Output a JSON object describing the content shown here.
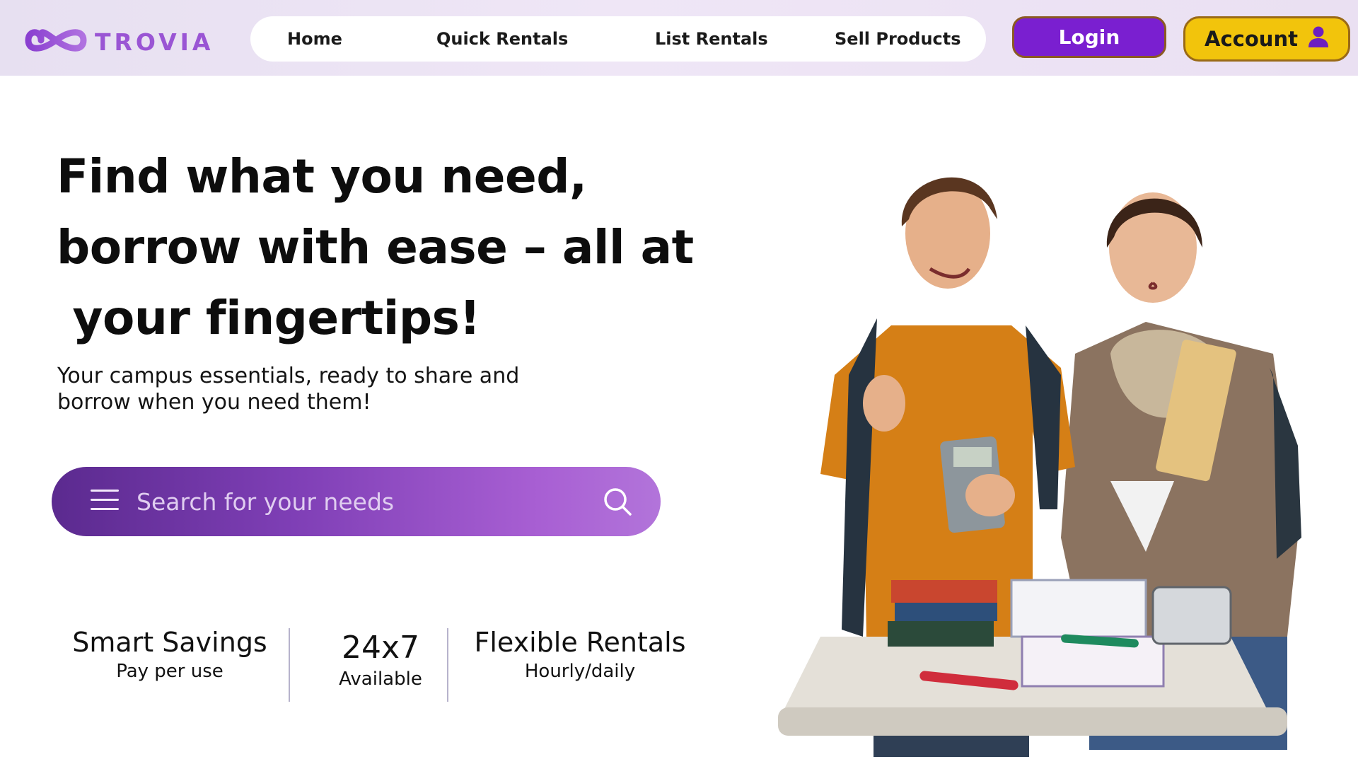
{
  "brand": {
    "name": "TROVIA",
    "logo_icon": "infinity-icon"
  },
  "nav": {
    "items": [
      {
        "label": "Home"
      },
      {
        "label": "Quick Rentals"
      },
      {
        "label": "List Rentals"
      },
      {
        "label": "Sell Products"
      }
    ]
  },
  "header_actions": {
    "login_label": "Login",
    "account_label": "Account",
    "account_icon": "user-icon"
  },
  "hero": {
    "headline_lines": [
      "Find what you need,",
      "borrow with ease – all at",
      " your fingertips!"
    ],
    "subline_lines": [
      "Your campus essentials, ready to share and",
      "borrow when you need them!"
    ]
  },
  "search": {
    "placeholder": "Search for your needs",
    "menu_icon": "menu-icon",
    "search_icon": "search-icon"
  },
  "features": [
    {
      "title": "Smart Savings",
      "subtitle": "Pay per use"
    },
    {
      "title": "24x7",
      "subtitle": "Available"
    },
    {
      "title": "Flexible Rentals",
      "subtitle": "Hourly/daily"
    }
  ],
  "colors": {
    "brand_purple": "#7a1fd0",
    "logo_purple": "#9a55d4",
    "account_yellow": "#f2c40c",
    "search_gradient_start": "#5b2a8f",
    "search_gradient_end": "#b274da"
  }
}
